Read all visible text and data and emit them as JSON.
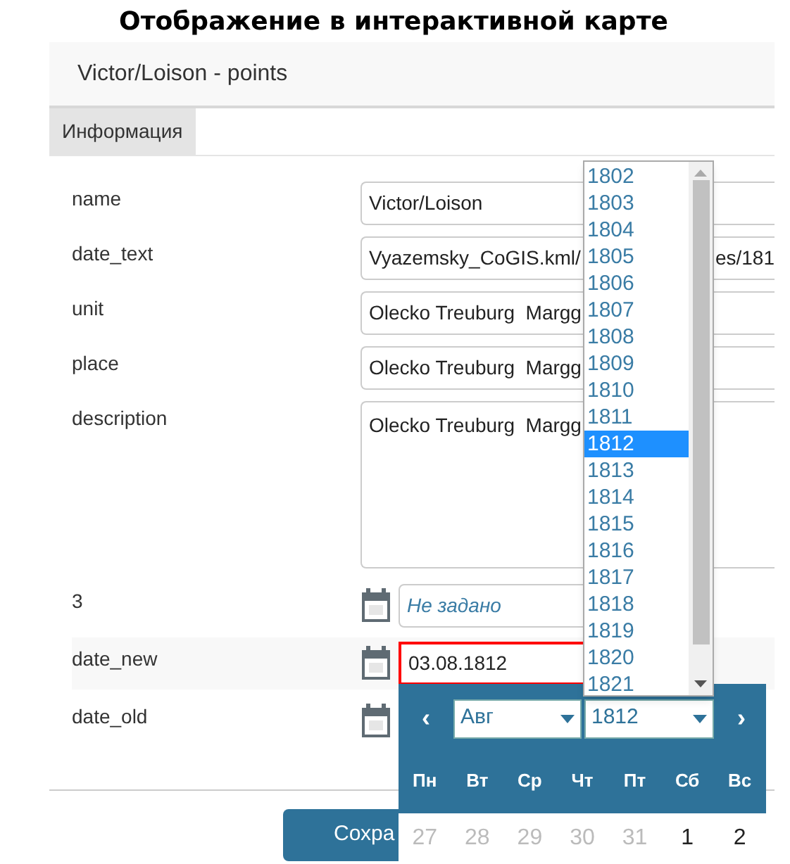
{
  "heading": "Отображение в интерактивной карте",
  "panel": {
    "title": "Victor/Loison - points"
  },
  "tabs": [
    {
      "label": "Информация",
      "selected": true
    }
  ],
  "fields": [
    {
      "kind": "text",
      "label": "name",
      "value": "Victor/Loison"
    },
    {
      "kind": "text",
      "label": "date_text",
      "value": "Vyazemsky_CoGIS.kml/",
      "value_tail": "es/181"
    },
    {
      "kind": "text",
      "label": "unit",
      "value": "Olecko Treuburg  Margg"
    },
    {
      "kind": "text",
      "label": "place",
      "value": "Olecko Treuburg  Margg"
    },
    {
      "kind": "textarea",
      "label": "description",
      "value": "Olecko Treuburg  Margg"
    },
    {
      "kind": "date",
      "label": "3",
      "placeholder": "Не задано",
      "highlighted": false
    },
    {
      "kind": "date",
      "label": "date_new",
      "value": "03.08.1812",
      "highlighted": true
    },
    {
      "kind": "date",
      "label": "date_old"
    }
  ],
  "save_button": "Сохра",
  "year_list": [
    {
      "label": "1802",
      "selected": false
    },
    {
      "label": "1803",
      "selected": false
    },
    {
      "label": "1804",
      "selected": false
    },
    {
      "label": "1805",
      "selected": false
    },
    {
      "label": "1806",
      "selected": false
    },
    {
      "label": "1807",
      "selected": false
    },
    {
      "label": "1808",
      "selected": false
    },
    {
      "label": "1809",
      "selected": false
    },
    {
      "label": "1810",
      "selected": false
    },
    {
      "label": "1811",
      "selected": false
    },
    {
      "label": "1812",
      "selected": true
    },
    {
      "label": "1813",
      "selected": false
    },
    {
      "label": "1814",
      "selected": false
    },
    {
      "label": "1815",
      "selected": false
    },
    {
      "label": "1816",
      "selected": false
    },
    {
      "label": "1817",
      "selected": false
    },
    {
      "label": "1818",
      "selected": false
    },
    {
      "label": "1819",
      "selected": false
    },
    {
      "label": "1820",
      "selected": false
    },
    {
      "label": "1821",
      "selected": false
    }
  ],
  "datepicker": {
    "prev": "‹",
    "next": "›",
    "month": "Авг",
    "year": "1812",
    "weekdays": [
      "Пн",
      "Вт",
      "Ср",
      "Чт",
      "Пт",
      "Сб",
      "Вс"
    ],
    "days": [
      {
        "label": "27",
        "other_month": true
      },
      {
        "label": "28",
        "other_month": true
      },
      {
        "label": "29",
        "other_month": true
      },
      {
        "label": "30",
        "other_month": true
      },
      {
        "label": "31",
        "other_month": true
      },
      {
        "label": "1",
        "other_month": false
      },
      {
        "label": "2",
        "other_month": false
      }
    ]
  }
}
